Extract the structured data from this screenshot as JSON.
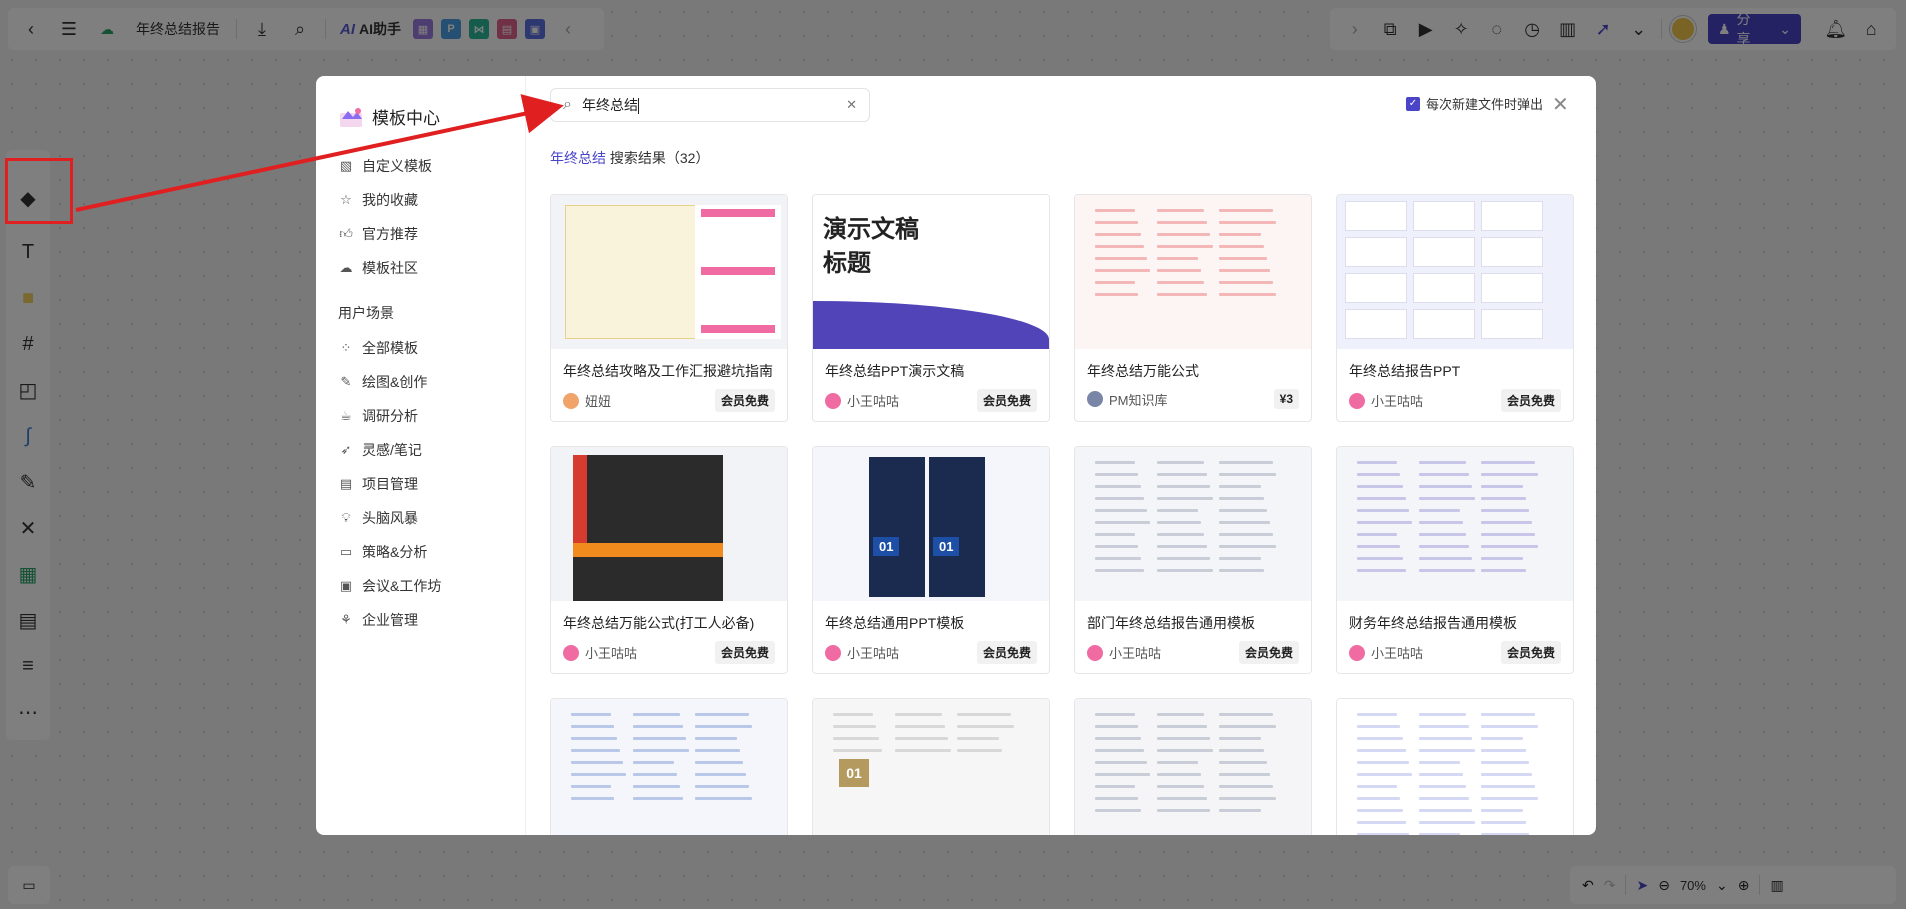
{
  "topbar": {
    "doc_title": "年终总结报告",
    "ai_label": "AI助手",
    "ai_logo": "AI",
    "mini_p": "P",
    "share_label": "分享"
  },
  "colors": {
    "accent": "#4a44c9",
    "highlight": "#e02020"
  },
  "bottom": {
    "zoom": "70%"
  },
  "modal": {
    "title": "模板中心",
    "nav": [
      {
        "label": "自定义模板",
        "icon": "image-icon"
      },
      {
        "label": "我的收藏",
        "icon": "star-icon"
      },
      {
        "label": "官方推荐",
        "icon": "thumb-icon"
      },
      {
        "label": "模板社区",
        "icon": "community-icon"
      }
    ],
    "section_title": "用户场景",
    "scenes": [
      {
        "label": "全部模板",
        "icon": "grid-icon"
      },
      {
        "label": "绘图&创作",
        "icon": "pen-icon"
      },
      {
        "label": "调研分析",
        "icon": "cup-icon"
      },
      {
        "label": "灵感/笔记",
        "icon": "rocket-icon"
      },
      {
        "label": "项目管理",
        "icon": "doc-icon"
      },
      {
        "label": "头脑风暴",
        "icon": "bulb-icon"
      },
      {
        "label": "策略&分析",
        "icon": "strategy-icon"
      },
      {
        "label": "会议&工作坊",
        "icon": "meeting-icon"
      },
      {
        "label": "企业管理",
        "icon": "org-icon"
      }
    ],
    "search_value": "年终总结",
    "popup_option": "每次新建文件时弹出",
    "result_keyword": "年终总结",
    "result_text": "搜索结果（32）",
    "cards": [
      {
        "name": "年终总结攻略及工作汇报避坑指南",
        "author": "妞妞",
        "price": "会员免费",
        "avatar_color": "#f0a46a"
      },
      {
        "name": "年终总结PPT演示文稿",
        "author": "小王咕咕",
        "price": "会员免费",
        "avatar_color": "#f06ba2"
      },
      {
        "name": "年终总结万能公式",
        "author": "PM知识库",
        "price": "¥3",
        "avatar_color": "#7a86a8"
      },
      {
        "name": "年终总结报告PPT",
        "author": "小王咕咕",
        "price": "会员免费",
        "avatar_color": "#f06ba2"
      },
      {
        "name": "年终总结万能公式(打工人必备)",
        "author": "小王咕咕",
        "price": "会员免费",
        "avatar_color": "#f06ba2"
      },
      {
        "name": "年终总结通用PPT模板",
        "author": "小王咕咕",
        "price": "会员免费",
        "avatar_color": "#f06ba2"
      },
      {
        "name": "部门年终总结报告通用模板",
        "author": "小王咕咕",
        "price": "会员免费",
        "avatar_color": "#f06ba2"
      },
      {
        "name": "财务年终总结报告通用模板",
        "author": "小王咕咕",
        "price": "会员免费",
        "avatar_color": "#f06ba2"
      }
    ],
    "thumb2_title_l1": "演示文稿",
    "thumb2_title_l2": "标题",
    "thumb6_num": "01",
    "thumb10_num": "01"
  }
}
